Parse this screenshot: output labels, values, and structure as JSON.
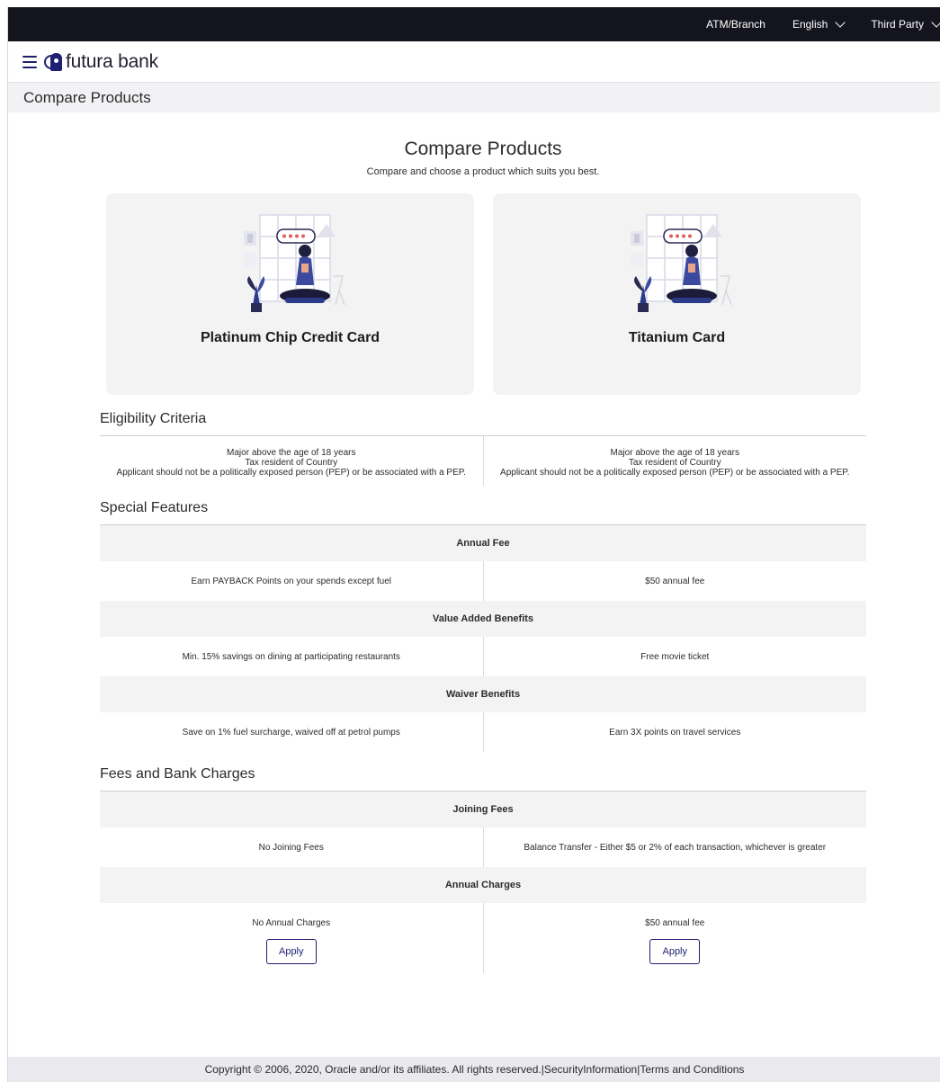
{
  "topbar": {
    "atm_branch": "ATM/Branch",
    "language": "English",
    "third_party": "Third Party"
  },
  "brand": {
    "name": "futura bank"
  },
  "page": {
    "title": "Compare Products"
  },
  "hero": {
    "heading": "Compare Products",
    "subheading": "Compare and choose a product which suits you best."
  },
  "products": [
    {
      "name": "Platinum Chip Credit Card"
    },
    {
      "name": "Titanium Card"
    }
  ],
  "eligibility": {
    "title": "Eligibility Criteria",
    "columns": [
      [
        "Major above the age of 18 years",
        "Tax resident of Country",
        "Applicant should not be a politically exposed person (PEP) or be associated with a PEP."
      ],
      [
        "Major above the age of 18 years",
        "Tax resident of Country",
        "Applicant should not be a politically exposed person (PEP) or be associated with a PEP."
      ]
    ]
  },
  "special_features": {
    "title": "Special Features",
    "groups": [
      {
        "heading": "Annual Fee",
        "values": [
          "Earn PAYBACK Points on your spends except fuel",
          "$50 annual fee"
        ]
      },
      {
        "heading": "Value Added Benefits",
        "values": [
          "Min. 15% savings on dining at participating restaurants",
          "Free movie ticket"
        ]
      },
      {
        "heading": "Waiver Benefits",
        "values": [
          "Save on 1% fuel surcharge, waived off at petrol pumps",
          "Earn 3X points on travel services"
        ]
      }
    ]
  },
  "fees": {
    "title": "Fees and Bank Charges",
    "groups": [
      {
        "heading": "Joining Fees",
        "values": [
          "No Joining Fees",
          "Balance Transfer - Either $5 or 2% of each transaction, whichever is greater"
        ]
      },
      {
        "heading": "Annual Charges",
        "values": [
          "No Annual Charges",
          "$50 annual fee"
        ]
      }
    ],
    "apply_label": "Apply"
  },
  "footer": {
    "copyright": "Copyright © 2006, 2020, Oracle and/or its affiliates. All rights reserved.|",
    "security": "SecurityInformation",
    "separator": "|",
    "terms": "Terms and Conditions"
  },
  "colors": {
    "topbar_bg": "#14141e",
    "brand_navy": "#1f1f73",
    "panel_grey": "#f3f3f3"
  }
}
